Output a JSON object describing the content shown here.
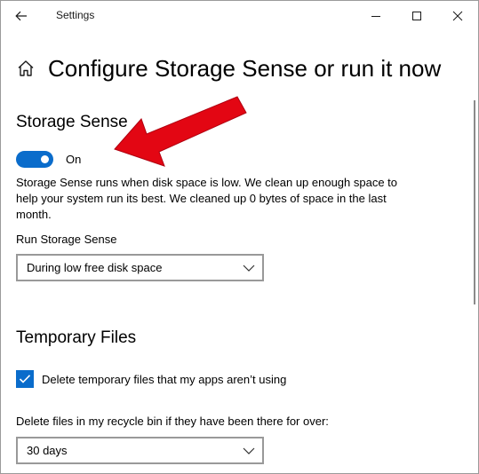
{
  "window": {
    "title": "Settings"
  },
  "header": {
    "title": "Configure Storage Sense or run it now"
  },
  "storage_sense": {
    "section_title": "Storage Sense",
    "toggle_state": "On",
    "description": "Storage Sense runs when disk space is low. We clean up enough space to help your system run its best. We cleaned up 0 bytes of space in the last month.",
    "run_label": "Run Storage Sense",
    "run_selected": "During low free disk space"
  },
  "temporary_files": {
    "section_title": "Temporary Files",
    "checkbox_label": "Delete temporary files that my apps aren’t using",
    "recycle_label": "Delete files in my recycle bin if they have been there for over:",
    "recycle_selected": "30 days"
  },
  "colors": {
    "accent": "#0a6ccb",
    "annotation": "#e30613"
  },
  "icons": {
    "back": "back-arrow-icon",
    "home": "home-icon",
    "minimize": "minimize-icon",
    "maximize": "maximize-icon",
    "close": "close-icon",
    "chevron": "chevron-down-icon",
    "check": "checkmark-icon"
  }
}
